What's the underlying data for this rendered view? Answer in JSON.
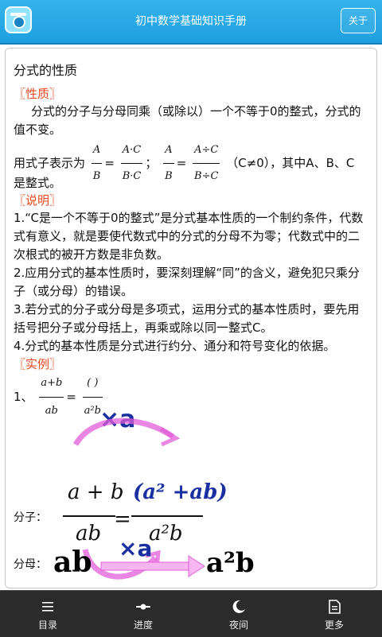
{
  "header": {
    "title": "初中数学基础知识手册",
    "about_label": "关于"
  },
  "page": {
    "title": "分式的性质",
    "sec1": "〖性质〗",
    "prop_text": "分式的分子与分母同乘（或除以）一个不等于0的整式，分式的值不变。",
    "expr_prefix": "用式子表示为",
    "expr_suffix": "（C≠0），其中A、B、C",
    "expr_line2": "是整式。",
    "sec2": "〖说明〗",
    "notes": [
      "1.“C是一个不等于0的整式”是分式基本性质的一个制约条件，代数式有意义，就是要使代数式中的分式的分母不为零；代数式中的二次根式的被开方数是非负数。",
      "2.应用分式的基本性质时，要深刻理解“同”的含义，避免犯只乘分子（或分母）的错误。",
      "3.若分式的分子或分母是多项式，运用分式的基本性质时，要先用括号把分子或分母括上，再乘或除以同一整式C。",
      "4.分式的基本性质是分式进行约分、通分和符号变化的依据。"
    ],
    "sec3": "〖实例〗",
    "ex_num": "1、",
    "ex_num_frac": "a+b",
    "ex_den_frac": "ab",
    "ex_rhs_num": "(        )",
    "ex_rhs_den": "a²b",
    "times_a": "×a",
    "numer_label": "分子：",
    "big_num_l": "a + b",
    "big_den_l": "ab",
    "big_num_r": "(a² +ab)",
    "big_den_r": "a²b",
    "denom_label": "分母：",
    "ab_big": "ab",
    "a2b_big": "a²b"
  },
  "nav": [
    {
      "label": "目录",
      "icon": "list-icon"
    },
    {
      "label": "进度",
      "icon": "slider-icon"
    },
    {
      "label": "夜间",
      "icon": "moon-icon"
    },
    {
      "label": "更多",
      "icon": "document-icon"
    }
  ]
}
